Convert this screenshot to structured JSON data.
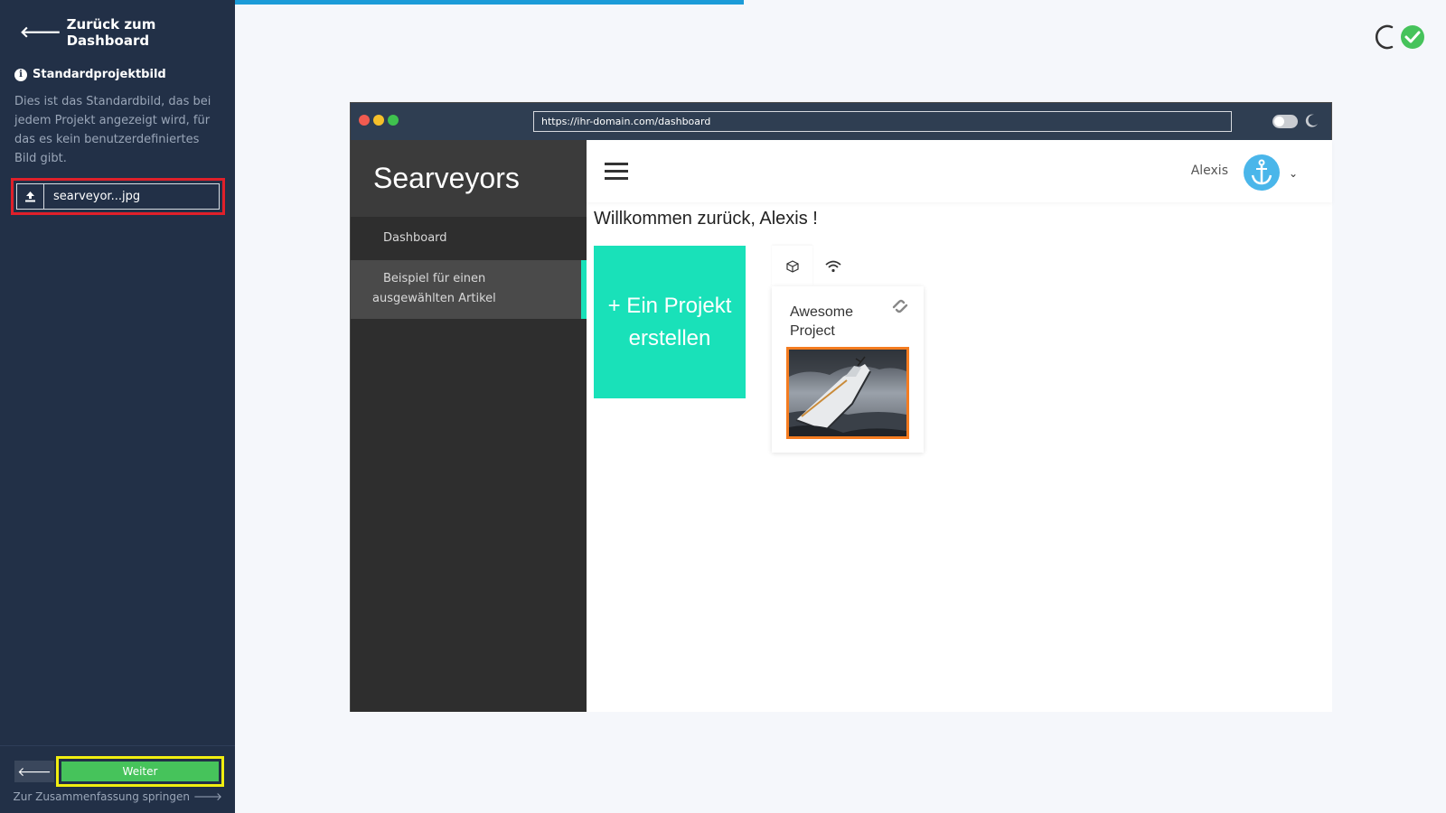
{
  "left_panel": {
    "back_label": "Zurück zum Dashboard",
    "section_title": "Standardprojektbild",
    "section_desc": "Dies ist das Standardbild, das bei jedem Projekt angezeigt wird, für das es kein benutzerdefiniertes Bild gibt.",
    "file_name": "searveyor...jpg",
    "next_label": "Weiter",
    "skip_label": "Zur Zusammenfassung springen",
    "highlight_colors": {
      "file_field": "#e0202a",
      "next_button": "#f1ee10"
    }
  },
  "progress": {
    "value_fraction": 0.42,
    "color": "#1b9bd8"
  },
  "browser": {
    "url": "https://ihr-domain.com/dashboard",
    "app": {
      "brand": "Searveyors",
      "menu": [
        {
          "label": "Dashboard"
        },
        {
          "label_line1": "Beispiel für einen",
          "label_line2": "ausgewählten Artikel"
        }
      ],
      "user_name": "Alexis",
      "welcome": "Willkommen zurück, Alexis !",
      "create_line1": "+ Ein Projekt",
      "create_line2": "erstellen",
      "project": {
        "title": "Awesome Project"
      },
      "accent_color": "#19e1b9"
    }
  },
  "icons": {
    "back": "arrow-left-icon",
    "info": "info-icon",
    "upload": "upload-icon",
    "status": "spinner-check-icon",
    "avatar": "anchor-icon",
    "tab1": "cube-icon",
    "tab2": "wifi-icon",
    "link": "link-icon"
  }
}
